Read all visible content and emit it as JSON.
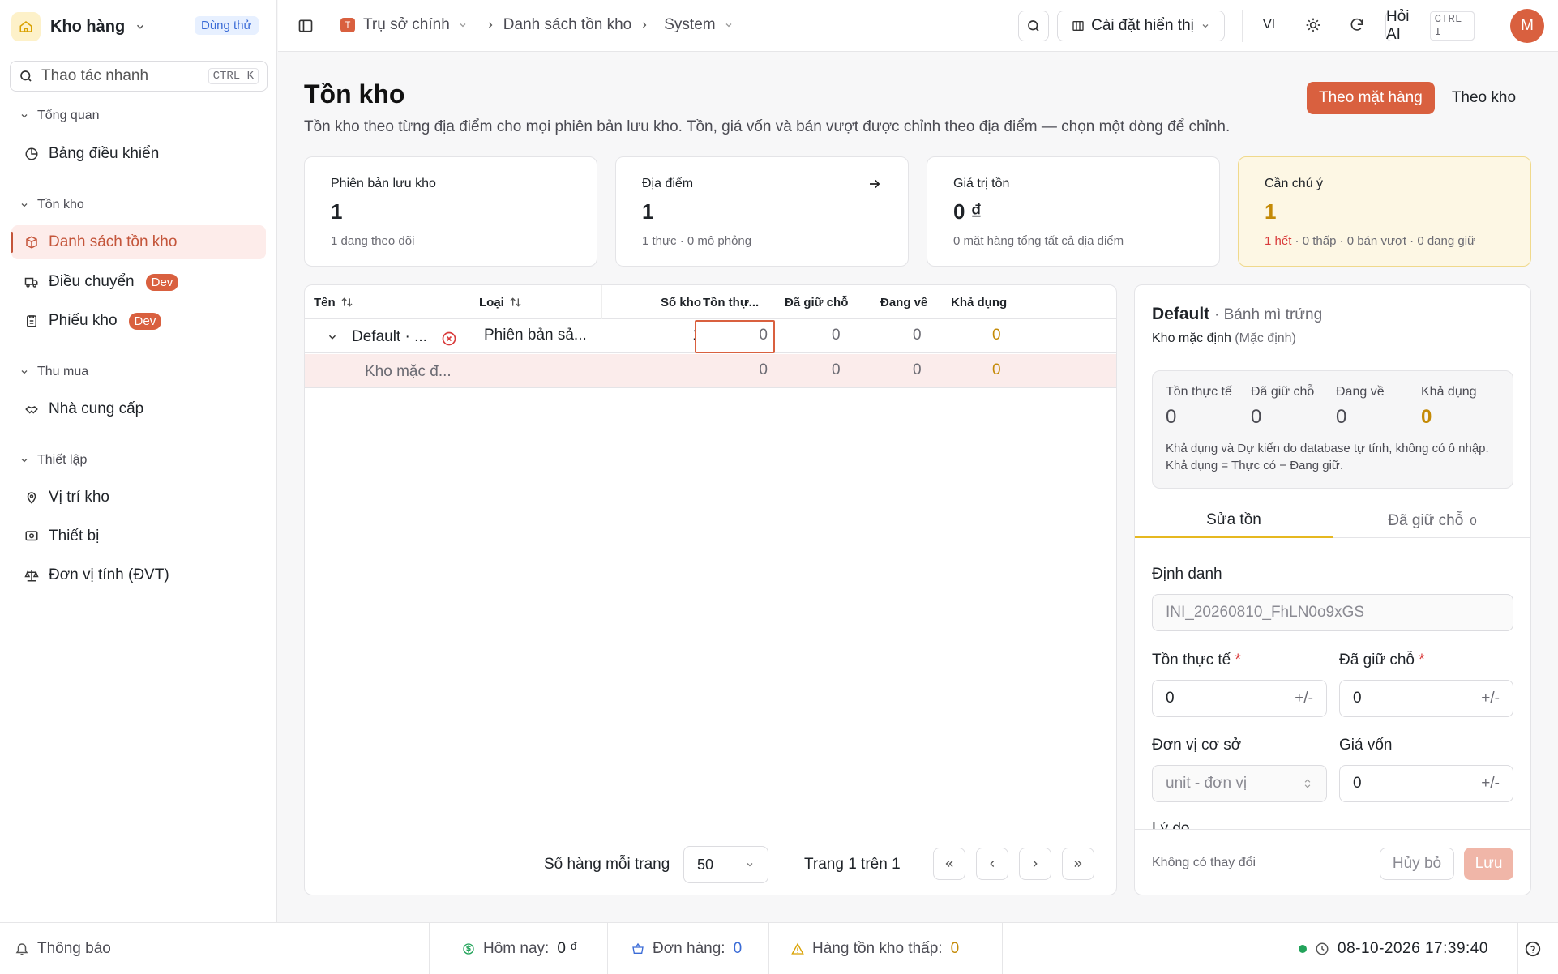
{
  "sidebar": {
    "brand": "Kho hàng",
    "trial_badge": "Dùng thử",
    "quick_actions": {
      "label": "Thao tác nhanh",
      "shortcut": "CTRL K"
    },
    "groups": [
      {
        "label": "Tổng quan",
        "items": [
          {
            "label": "Bảng điều khiển"
          }
        ]
      },
      {
        "label": "Tồn kho",
        "items": [
          {
            "label": "Danh sách tồn kho",
            "active": true
          },
          {
            "label": "Điều chuyển",
            "badge": "Dev"
          },
          {
            "label": "Phiếu kho",
            "badge": "Dev"
          }
        ]
      },
      {
        "label": "Thu mua",
        "items": [
          {
            "label": "Nhà cung cấp"
          }
        ]
      },
      {
        "label": "Thiết lập",
        "items": [
          {
            "label": "Vị trí kho"
          },
          {
            "label": "Thiết bị"
          },
          {
            "label": "Đơn vị tính (ĐVT)"
          }
        ]
      }
    ]
  },
  "topbar": {
    "org_initial": "T",
    "org": "Trụ sở chính",
    "crumb_page": "Danh sách tồn kho",
    "crumb_scope": "System",
    "display_settings": "Cài đặt hiển thị",
    "language": "VI",
    "ask_ai": "Hỏi AI",
    "ask_ai_shortcut": "CTRL I",
    "avatar": "M"
  },
  "page": {
    "title": "Tồn kho",
    "subtitle": "Tồn kho theo từng địa điểm cho mọi phiên bản lưu kho. Tồn, giá vốn và bán vượt được chỉnh theo địa điểm — chọn một dòng để chỉnh.",
    "view_toggle": [
      "Theo mặt hàng",
      "Theo kho"
    ]
  },
  "stats": [
    {
      "label": "Phiên bản lưu kho",
      "value": "1",
      "sub": "1 đang theo dõi"
    },
    {
      "label": "Địa điểm",
      "value": "1",
      "sub": "1 thực · 0 mô phỏng"
    },
    {
      "label": "Giá trị tồn",
      "value": "0 ₫",
      "sub": "0 mặt hàng tổng tất cả địa điểm"
    },
    {
      "label": "Cần chú ý",
      "value": "1",
      "sub_red": "1 hết",
      "sub": " · 0 thấp · 0 bán vượt · 0 đang giữ"
    }
  ],
  "table": {
    "columns": [
      "Tên",
      "Loại",
      "Số kho",
      "Tồn thự...",
      "Đã giữ chỗ",
      "Đang về",
      "Khả dụng"
    ],
    "rows": [
      {
        "name": "Default · ...",
        "type": "Phiên bản sả...",
        "locations": "1",
        "on_hand": "0",
        "reserved": "0",
        "incoming": "0",
        "available": "0"
      },
      {
        "name": "Kho mặc đ...",
        "on_hand": "0",
        "reserved": "0",
        "incoming": "0",
        "available": "0"
      }
    ],
    "rows_per_page_label": "Số hàng mỗi trang",
    "rows_per_page": "50",
    "page_info": "Trang 1 trên 1"
  },
  "panel": {
    "title": "Default",
    "title_suffix": "· Bánh mì trứng",
    "location": "Kho mặc định",
    "location_suffix": "(Mặc định)",
    "stats": [
      {
        "label": "Tồn thực tế",
        "value": "0"
      },
      {
        "label": "Đã giữ chỗ",
        "value": "0"
      },
      {
        "label": "Đang về",
        "value": "0"
      },
      {
        "label": "Khả dụng",
        "value": "0"
      }
    ],
    "note": "Khả dụng và Dự kiến do database tự tính, không có ô nhập. Khả dụng = Thực có − Đang giữ.",
    "tabs": [
      {
        "label": "Sửa tồn"
      },
      {
        "label": "Đã giữ chỗ",
        "count": "0"
      }
    ],
    "form": {
      "id_label": "Định danh",
      "id_value": "INI_20260810_FhLN0o9xGS",
      "on_hand_label": "Tồn thực tế",
      "on_hand_value": "0",
      "reserved_label": "Đã giữ chỗ",
      "reserved_value": "0",
      "step": "+/-",
      "unit_label": "Đơn vị cơ sở",
      "unit_value": "unit - đơn vị",
      "cost_label": "Giá vốn",
      "cost_value": "0",
      "reason_label": "Lý do"
    },
    "footer": {
      "status": "Không có thay đổi",
      "cancel": "Hủy bỏ",
      "save": "Lưu"
    }
  },
  "statusbar": {
    "notifications": "Thông báo",
    "today_label": "Hôm nay:",
    "today_value": "0 ₫",
    "orders_label": "Đơn hàng:",
    "orders_value": "0",
    "low_stock_label": "Hàng tồn kho thấp:",
    "low_stock_value": "0",
    "datetime": "08-10-2026 17:39:40"
  },
  "colors": {
    "accent": "#d9603f",
    "amber": "#c48a06",
    "danger": "#d93b3b",
    "online": "#22a35a"
  }
}
